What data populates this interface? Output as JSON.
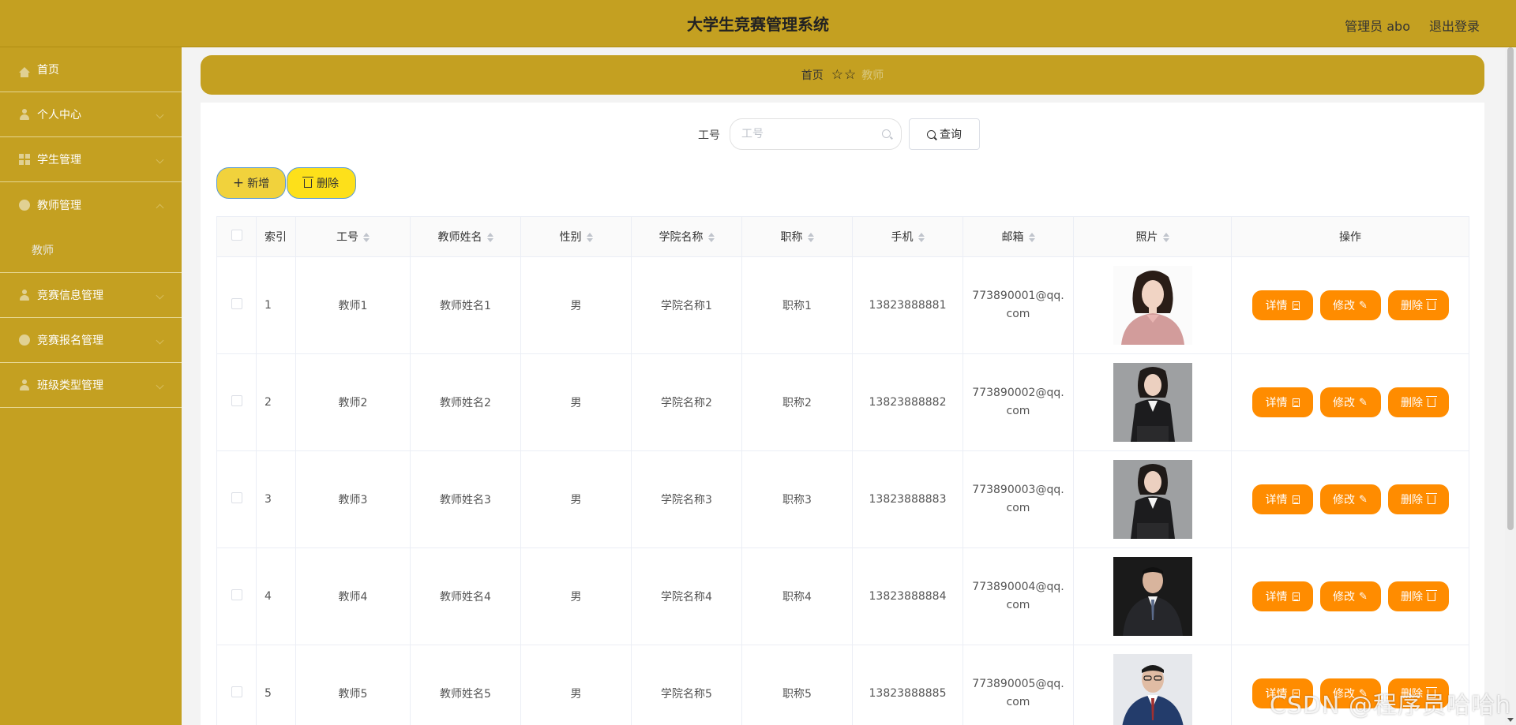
{
  "header": {
    "title": "大学生竞赛管理系统",
    "user": "管理员 abo",
    "logout": "退出登录"
  },
  "sidebar": {
    "items": [
      {
        "label": "首页",
        "icon": "home-icon"
      },
      {
        "label": "个人中心",
        "icon": "user-icon"
      },
      {
        "label": "学生管理",
        "icon": "grid-icon"
      },
      {
        "label": "教师管理",
        "icon": "circle-icon"
      },
      {
        "label": "教师",
        "sub": true
      },
      {
        "label": "竞赛信息管理",
        "icon": "user-icon"
      },
      {
        "label": "竞赛报名管理",
        "icon": "circle-icon"
      },
      {
        "label": "班级类型管理",
        "icon": "user-icon"
      }
    ]
  },
  "breadcrumb": {
    "home": "首页",
    "stars": "☆☆",
    "current": "教师"
  },
  "search": {
    "label": "工号",
    "placeholder": "工号",
    "button": "查询"
  },
  "actions": {
    "add": "新增",
    "delete": "删除"
  },
  "table": {
    "headers": [
      "索引",
      "工号",
      "教师姓名",
      "性别",
      "学院名称",
      "职称",
      "手机",
      "邮箱",
      "照片",
      "操作"
    ],
    "rows": [
      {
        "index": "1",
        "id": "教师1",
        "name": "教师姓名1",
        "gender": "男",
        "college": "学院名称1",
        "title": "职称1",
        "phone": "13823888881",
        "email": "773890001@qq.com",
        "photo_style": "light"
      },
      {
        "index": "2",
        "id": "教师2",
        "name": "教师姓名2",
        "gender": "男",
        "college": "学院名称2",
        "title": "职称2",
        "phone": "13823888882",
        "email": "773890002@qq.com",
        "photo_style": "gray"
      },
      {
        "index": "3",
        "id": "教师3",
        "name": "教师姓名3",
        "gender": "男",
        "college": "学院名称3",
        "title": "职称3",
        "phone": "13823888883",
        "email": "773890003@qq.com",
        "photo_style": "gray"
      },
      {
        "index": "4",
        "id": "教师4",
        "name": "教师姓名4",
        "gender": "男",
        "college": "学院名称4",
        "title": "职称4",
        "phone": "13823888884",
        "email": "773890004@qq.com",
        "photo_style": "dark"
      },
      {
        "index": "5",
        "id": "教师5",
        "name": "教师姓名5",
        "gender": "男",
        "college": "学院名称5",
        "title": "职称5",
        "phone": "13823888885",
        "email": "773890005@qq.com",
        "photo_style": "blue"
      }
    ],
    "op_labels": {
      "detail": "详情",
      "edit": "修改",
      "delete": "删除"
    }
  },
  "watermark": "CSDN @程序员哈哈h",
  "colors": {
    "accent": "#c4a021",
    "op_button": "#ff8c00",
    "add_button": "#f1d23c",
    "delete_button": "#fde01a"
  }
}
